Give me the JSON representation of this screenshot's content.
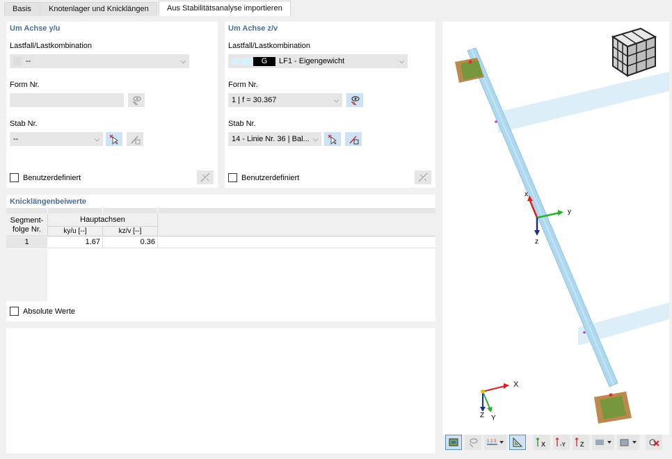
{
  "tabs": [
    {
      "label": "Basis",
      "active": false
    },
    {
      "label": "Knotenlager und Knicklängen",
      "active": false
    },
    {
      "label": "Aus Stabilitätsanalyse importieren",
      "active": true
    }
  ],
  "left_panel": {
    "title": "Um Achse y/u",
    "loadcase_label": "Lastfall/Lastkombination",
    "loadcase_value": "--",
    "form_label": "Form Nr.",
    "form_value": "",
    "member_label": "Stab Nr.",
    "member_value": "--",
    "userdef_label": "Benutzerdefiniert"
  },
  "right_panel": {
    "title": "Um Achse z/v",
    "loadcase_label": "Lastfall/Lastkombination",
    "loadcase_tag": "G",
    "loadcase_value": "LF1 - Eigengewicht",
    "form_label": "Form Nr.",
    "form_value": "1 | f = 30.367",
    "member_label": "Stab Nr.",
    "member_value": "14 - Linie Nr. 36 | Bal...",
    "userdef_label": "Benutzerdefiniert"
  },
  "coeffs": {
    "title": "Knicklängenbeiwerte",
    "col_segment": "Segment-\nfolge Nr.",
    "col_group": "Hauptachsen",
    "col_ky": "ky/u [--]",
    "col_kz": "kz/v [--]",
    "rows": [
      {
        "seg": "1",
        "ky": "1.67",
        "kz": "0.36"
      }
    ],
    "absolute_label": "Absolute Werte"
  },
  "viewport": {
    "axis_x": "x",
    "axis_y": "y",
    "axis_z": "z",
    "global_x": "X",
    "global_y": "Y",
    "global_z": "Z"
  }
}
